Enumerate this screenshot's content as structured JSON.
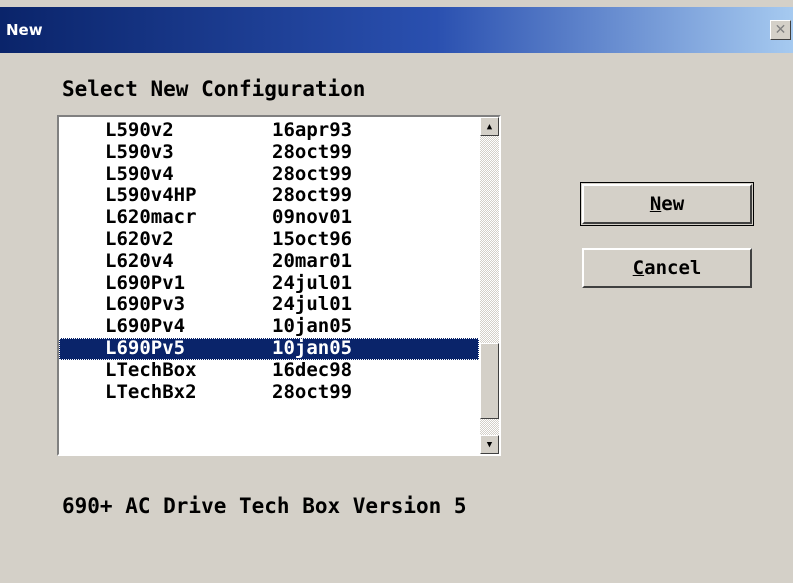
{
  "window": {
    "title": "New",
    "close_glyph": "✕"
  },
  "heading": "Select New Configuration",
  "configurations": [
    {
      "name": "L590v2",
      "date": "16apr93"
    },
    {
      "name": "L590v3",
      "date": "28oct99"
    },
    {
      "name": "L590v4",
      "date": "28oct99"
    },
    {
      "name": "L590v4HP",
      "date": "28oct99"
    },
    {
      "name": "L620macr",
      "date": "09nov01"
    },
    {
      "name": "L620v2",
      "date": "15oct96"
    },
    {
      "name": "L620v4",
      "date": "20mar01"
    },
    {
      "name": "L690Pv1",
      "date": "24jul01"
    },
    {
      "name": "L690Pv3",
      "date": "24jul01"
    },
    {
      "name": "L690Pv4",
      "date": "10jan05"
    },
    {
      "name": "L690Pv5",
      "date": "10jan05",
      "selected": true
    },
    {
      "name": "LTechBox",
      "date": "16dec98"
    },
    {
      "name": "LTechBx2",
      "date": "28oct99"
    }
  ],
  "scrollbar": {
    "up_glyph": "▲",
    "down_glyph": "▼"
  },
  "buttons": {
    "new": {
      "mnemonic": "N",
      "rest": "ew"
    },
    "cancel": {
      "mnemonic": "C",
      "rest": "ancel"
    }
  },
  "description": "690+ AC Drive Tech Box Version 5",
  "colors": {
    "face": "#d4d0c8",
    "title_start": "#0a246a",
    "title_end": "#a6caf0",
    "selection": "#0a246a"
  }
}
